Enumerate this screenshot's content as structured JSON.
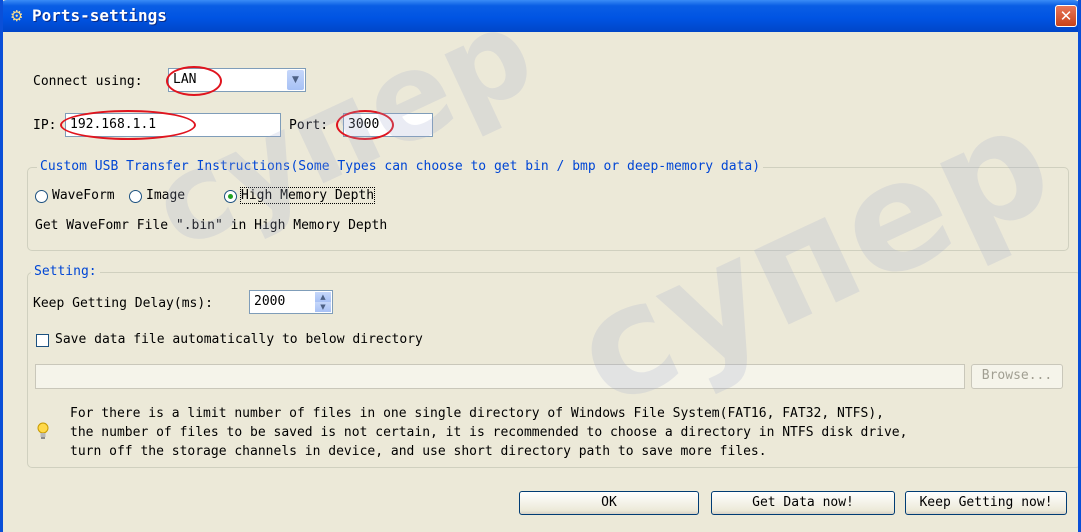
{
  "window": {
    "title": "Ports-settings"
  },
  "connection": {
    "connect_label": "Connect using:",
    "connect_value": "LAN",
    "ip_label": "IP:",
    "ip_value": "192.168.1.1",
    "port_label": "Port:",
    "port_value": "3000"
  },
  "usb_group": {
    "legend": "Custom USB Transfer Instructions(Some Types can choose to get bin / bmp or deep-memory data)",
    "options": [
      {
        "label": "WaveForm",
        "selected": false
      },
      {
        "label": "Image",
        "selected": false
      },
      {
        "label": "High Memory Depth",
        "selected": true
      }
    ],
    "description": "Get WaveFomr File \".bin\" in High Memory Depth"
  },
  "setting_group": {
    "legend": "Setting:",
    "delay_label": "Keep Getting Delay(ms):",
    "delay_value": "2000",
    "save_checkbox_label": "Save data file automatically to below directory",
    "save_checked": false,
    "directory_value": "",
    "browse_label": "Browse...",
    "note_lines": [
      "For there is a limit number of files in one single directory of Windows File System(FAT16, FAT32, NTFS),",
      "the number of  files to be saved is not certain,  it is recommended to choose a directory in NTFS disk drive,",
      "turn off the storage channels in device, and use short directory path to save more files."
    ]
  },
  "buttons": {
    "ok": "OK",
    "get_data": "Get Data now!",
    "keep_getting": "Keep Getting now!"
  },
  "watermark": {
    "text": "супер"
  },
  "colors": {
    "titlebar": "#0054e3",
    "group_legend": "#0046d5",
    "annotation": "#e0141e"
  }
}
